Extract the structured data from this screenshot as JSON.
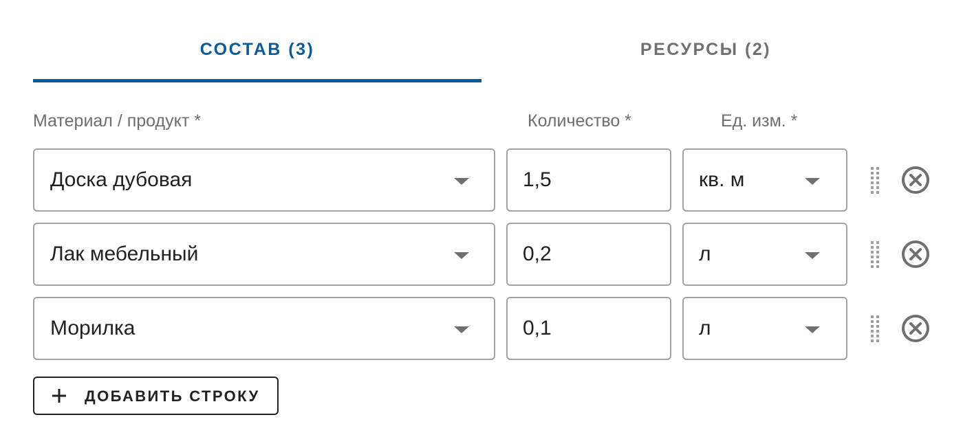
{
  "tabs": [
    {
      "label": "СОСТАВ (3)",
      "active": true
    },
    {
      "label": "РЕСУРСЫ (2)",
      "active": false
    }
  ],
  "columns": {
    "material": "Материал / продукт *",
    "quantity": "Количество *",
    "unit": "Ед. изм. *"
  },
  "rows": [
    {
      "material": "Доска дубовая",
      "quantity": "1,5",
      "unit": "кв. м"
    },
    {
      "material": "Лак мебельный",
      "quantity": "0,2",
      "unit": "л"
    },
    {
      "material": "Морилка",
      "quantity": "0,1",
      "unit": "л"
    }
  ],
  "add_button": {
    "label": "ДОБАВИТЬ СТРОКУ",
    "icon": "plus-icon"
  },
  "icons": {
    "dropdown": "chevron-down-icon",
    "drag": "drag-handle-icon",
    "remove": "close-circle-icon"
  },
  "colors": {
    "accent": "#0d5a94",
    "inactive_tab": "#707070",
    "border": "#a2a2a2",
    "label": "#6e6e6e"
  }
}
